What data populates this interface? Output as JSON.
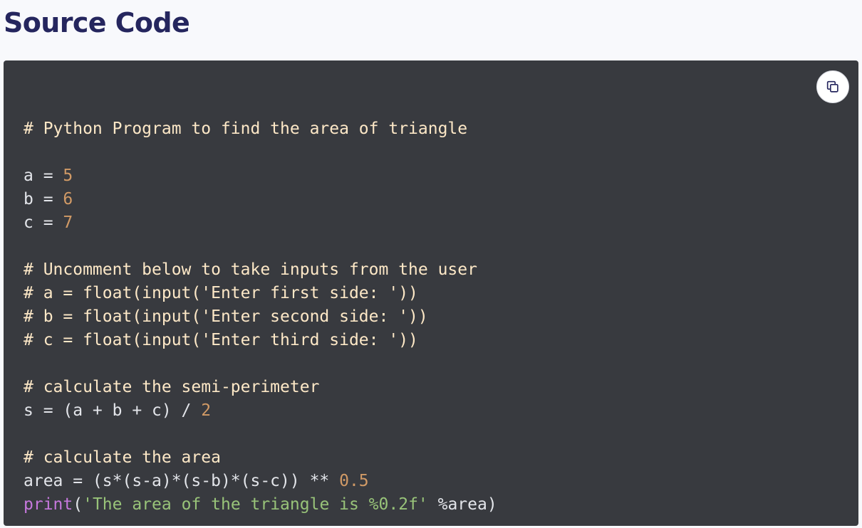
{
  "page": {
    "title": "Source Code"
  },
  "code_block": {
    "copy_icon": "copy-icon",
    "lines": [
      [],
      [
        {
          "type": "comment",
          "text": "# Python Program to find the area of triangle"
        }
      ],
      [],
      [
        {
          "type": "plain",
          "text": "a = "
        },
        {
          "type": "number",
          "text": "5"
        }
      ],
      [
        {
          "type": "plain",
          "text": "b = "
        },
        {
          "type": "number",
          "text": "6"
        }
      ],
      [
        {
          "type": "plain",
          "text": "c = "
        },
        {
          "type": "number",
          "text": "7"
        }
      ],
      [],
      [
        {
          "type": "comment",
          "text": "# Uncomment below to take inputs from the user"
        }
      ],
      [
        {
          "type": "comment",
          "text": "# a = float(input('Enter first side: '))"
        }
      ],
      [
        {
          "type": "comment",
          "text": "# b = float(input('Enter second side: '))"
        }
      ],
      [
        {
          "type": "comment",
          "text": "# c = float(input('Enter third side: '))"
        }
      ],
      [],
      [
        {
          "type": "comment",
          "text": "# calculate the semi-perimeter"
        }
      ],
      [
        {
          "type": "plain",
          "text": "s = (a + b + c) / "
        },
        {
          "type": "number",
          "text": "2"
        }
      ],
      [],
      [
        {
          "type": "comment",
          "text": "# calculate the area"
        }
      ],
      [
        {
          "type": "plain",
          "text": "area = (s*(s-a)*(s-b)*(s-c)) ** "
        },
        {
          "type": "number",
          "text": "0.5"
        }
      ],
      [
        {
          "type": "builtin",
          "text": "print"
        },
        {
          "type": "plain",
          "text": "("
        },
        {
          "type": "string",
          "text": "'The area of the triangle is %0.2f'"
        },
        {
          "type": "plain",
          "text": " %area)"
        }
      ]
    ]
  }
}
